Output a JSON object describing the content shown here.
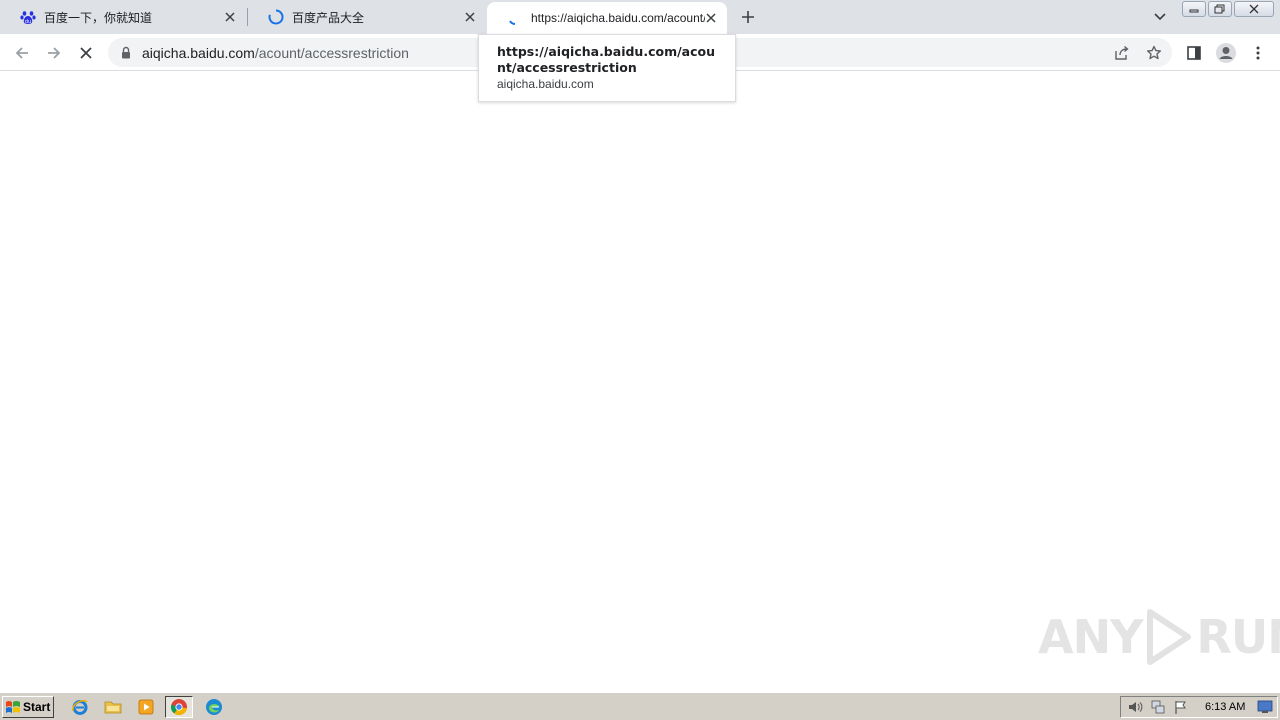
{
  "tabs": [
    {
      "title": "百度一下，你就知道",
      "state": "idle"
    },
    {
      "title": "百度产品大全",
      "state": "loading"
    },
    {
      "title": "https://aiqicha.baidu.com/acount/accessrestriction",
      "state": "loading",
      "active": true
    }
  ],
  "toolbar": {
    "url_host": "aiqicha.baidu.com",
    "url_path": "/acount/accessrestriction"
  },
  "hovercard": {
    "title": "https://aiqicha.baidu.com/acount/accessrestriction",
    "domain": "aiqicha.baidu.com"
  },
  "watermark": {
    "left": "ANY",
    "right": "RUN"
  },
  "taskbar": {
    "start_label": "Start",
    "clock": "6:13 AM"
  },
  "colors": {
    "tabstrip_bg": "#dee1e6",
    "omnibox_bg": "#f1f3f4",
    "loading_blue": "#1a73e8",
    "taskbar_bg": "#d4d0c8"
  }
}
